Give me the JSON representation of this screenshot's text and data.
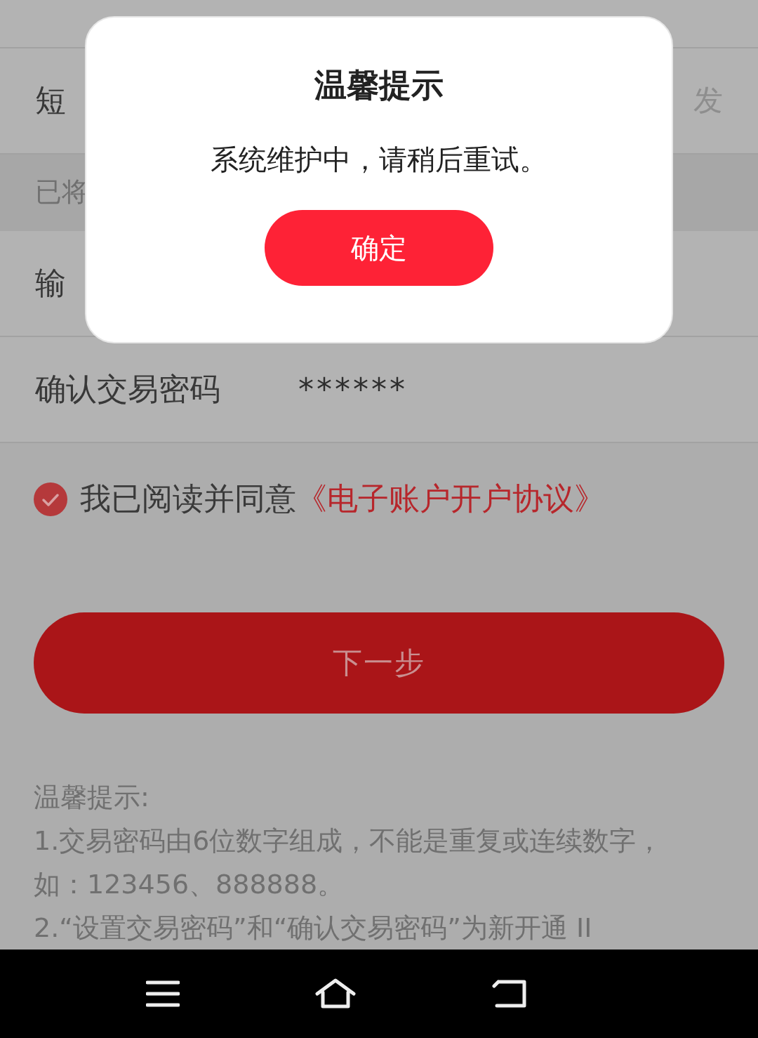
{
  "form": {
    "rows": [
      {
        "kind": "blank"
      },
      {
        "kind": "field",
        "label": "短",
        "action": "发"
      },
      {
        "kind": "note",
        "label": "已将"
      },
      {
        "kind": "field",
        "label": "输"
      },
      {
        "kind": "field",
        "label": "确认交易密码",
        "value": "******"
      }
    ]
  },
  "agreement": {
    "checked": true,
    "text": "我已阅读并同意",
    "link": "《电子账户开户协议》"
  },
  "next_button": "下一步",
  "tips": {
    "title": "温馨提示:",
    "items": [
      "1.交易密码由6位数字组成，不能是重复或连续数字，如：123456、888888。",
      "2.“设置交易密码”和“确认交易密码”为新开通 II"
    ]
  },
  "dialog": {
    "title": "温馨提示",
    "message": "系统维护中，请稍后重试。",
    "button": "确定"
  }
}
